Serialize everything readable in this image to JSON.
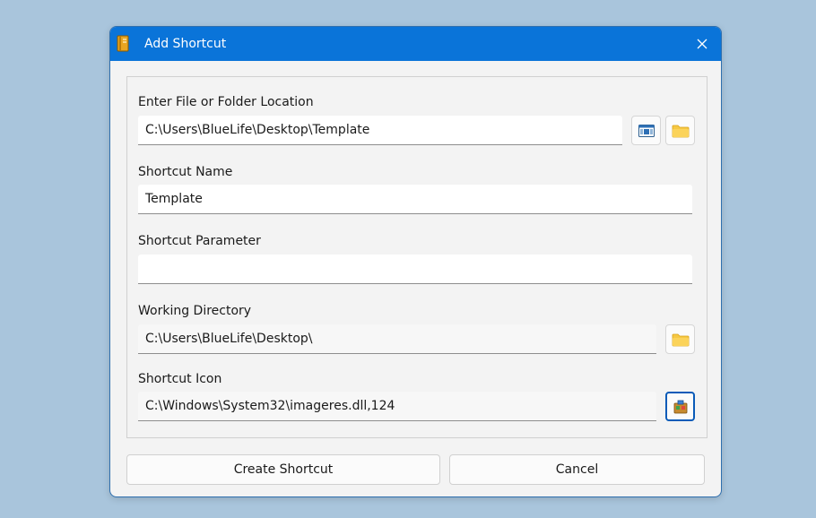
{
  "window": {
    "title": "Add Shortcut",
    "app_icon": "app-book-icon",
    "close_icon": "close-icon"
  },
  "fields": {
    "location": {
      "label": "Enter File or Folder Location",
      "value": "C:\\Users\\BlueLife\\Desktop\\Template"
    },
    "name": {
      "label": "Shortcut Name",
      "value": "Template"
    },
    "parameter": {
      "label": "Shortcut Parameter",
      "value": ""
    },
    "working_dir": {
      "label": "Working Directory",
      "value": "C:\\Users\\BlueLife\\Desktop\\"
    },
    "icon": {
      "label": "Shortcut Icon",
      "value": "C:\\Windows\\System32\\imageres.dll,124"
    }
  },
  "buttons": {
    "create": "Create Shortcut",
    "cancel": "Cancel"
  },
  "colors": {
    "titlebar": "#0a74d9",
    "background": "#a9c5dc",
    "folder": "#f6c843"
  }
}
